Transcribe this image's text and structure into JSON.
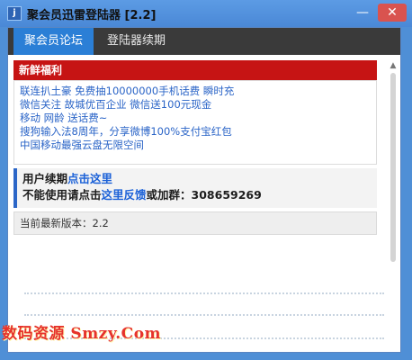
{
  "window": {
    "title": "聚会员迅雷登陆器 [2.2]",
    "icon_glyph": "j",
    "minimize_glyph": "—",
    "close_glyph": "✕"
  },
  "tabs": [
    {
      "label": "聚会员论坛",
      "active": true
    },
    {
      "label": "登陆器续期",
      "active": false
    }
  ],
  "banner": {
    "label": "新鲜福利"
  },
  "promo_lines": [
    "联连扒土豪 免费抽10000000手机话费 瞬时充",
    "微信关注 故城优百企业 微信送100元现金",
    "移动 网龄 送话费~",
    "搜狗输入法8周年，分享微博100%支付宝红包",
    "中国移动最强云盘无限空间"
  ],
  "renew": {
    "line1_prefix": "用户续期",
    "line1_link": "点击这里",
    "line2_prefix": "不能使用请点击",
    "line2_link": "这里反馈",
    "line2_suffix": "或加群：308659269"
  },
  "version": {
    "label": "当前最新版本：2.2"
  },
  "scrollbar": {
    "up_glyph": "▲"
  },
  "watermark": {
    "text": "数码资源 Smzy.Com"
  },
  "colors": {
    "accent": "#2b7fd6",
    "banner_red": "#c61414",
    "link_blue": "#1d62d8"
  }
}
